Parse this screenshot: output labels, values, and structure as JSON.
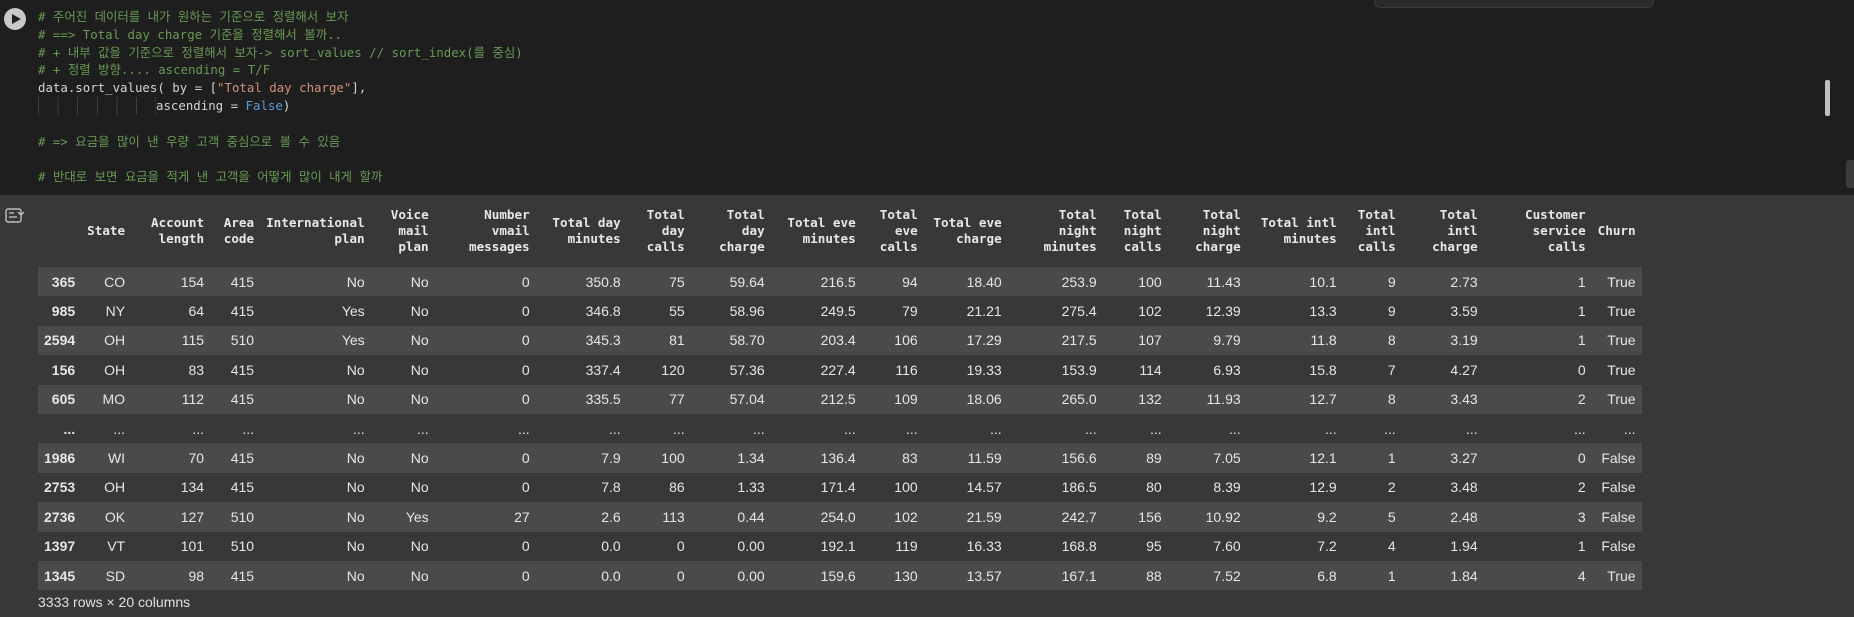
{
  "code": {
    "line1": "# 주어진 데이터를 내가 원하는 기준으로 정렬해서 보자",
    "line2": "# ==> Total day charge 기준을 정렬해서 볼까..",
    "line3": "# + 내부 값을 기준으로 정렬해서 보자-> sort_values // sort_index(를 중심)",
    "line4": "# + 정렬 방향.... ascending = T/F",
    "line5_a": "data.sort_values( by = [",
    "line5_b": "\"Total day charge\"",
    "line5_c": "],",
    "line6_a": "ascending = ",
    "line6_b": "False",
    "line6_c": ")",
    "line8": "# => 요금을 많이 낸 우량 고객 중심으로 볼 수 있음",
    "line10": "# 반대로 보면 요금을 적게 낸 고객을 어떻게 많이 내게 할까"
  },
  "table": {
    "columns": [
      [
        "",
        "",
        ""
      ],
      [
        "",
        "",
        "State"
      ],
      [
        "",
        "Account",
        "length"
      ],
      [
        "",
        "Area",
        "code"
      ],
      [
        "",
        "International",
        "plan"
      ],
      [
        "Voice",
        "mail",
        "plan"
      ],
      [
        "",
        "Number vmail",
        "messages"
      ],
      [
        "",
        "Total day",
        "minutes"
      ],
      [
        "Total",
        "day",
        "calls"
      ],
      [
        "",
        "Total day",
        "charge"
      ],
      [
        "",
        "Total eve",
        "minutes"
      ],
      [
        "Total",
        "eve",
        "calls"
      ],
      [
        "",
        "Total eve",
        "charge"
      ],
      [
        "Total",
        "night",
        "minutes"
      ],
      [
        "Total",
        "night",
        "calls"
      ],
      [
        "Total",
        "night",
        "charge"
      ],
      [
        "",
        "Total intl",
        "minutes"
      ],
      [
        "Total",
        "intl",
        "calls"
      ],
      [
        "Total",
        "intl",
        "charge"
      ],
      [
        "Customer",
        "service",
        "calls"
      ],
      [
        "",
        "",
        "Churn"
      ]
    ],
    "rows": [
      [
        "365",
        "CO",
        "154",
        "415",
        "No",
        "No",
        "0",
        "350.8",
        "75",
        "59.64",
        "216.5",
        "94",
        "18.40",
        "253.9",
        "100",
        "11.43",
        "10.1",
        "9",
        "2.73",
        "1",
        "True"
      ],
      [
        "985",
        "NY",
        "64",
        "415",
        "Yes",
        "No",
        "0",
        "346.8",
        "55",
        "58.96",
        "249.5",
        "79",
        "21.21",
        "275.4",
        "102",
        "12.39",
        "13.3",
        "9",
        "3.59",
        "1",
        "True"
      ],
      [
        "2594",
        "OH",
        "115",
        "510",
        "Yes",
        "No",
        "0",
        "345.3",
        "81",
        "58.70",
        "203.4",
        "106",
        "17.29",
        "217.5",
        "107",
        "9.79",
        "11.8",
        "8",
        "3.19",
        "1",
        "True"
      ],
      [
        "156",
        "OH",
        "83",
        "415",
        "No",
        "No",
        "0",
        "337.4",
        "120",
        "57.36",
        "227.4",
        "116",
        "19.33",
        "153.9",
        "114",
        "6.93",
        "15.8",
        "7",
        "4.27",
        "0",
        "True"
      ],
      [
        "605",
        "MO",
        "112",
        "415",
        "No",
        "No",
        "0",
        "335.5",
        "77",
        "57.04",
        "212.5",
        "109",
        "18.06",
        "265.0",
        "132",
        "11.93",
        "12.7",
        "8",
        "3.43",
        "2",
        "True"
      ],
      [
        "...",
        "...",
        "...",
        "...",
        "...",
        "...",
        "...",
        "...",
        "...",
        "...",
        "...",
        "...",
        "...",
        "...",
        "...",
        "...",
        "...",
        "...",
        "...",
        "...",
        "..."
      ],
      [
        "1986",
        "WI",
        "70",
        "415",
        "No",
        "No",
        "0",
        "7.9",
        "100",
        "1.34",
        "136.4",
        "83",
        "11.59",
        "156.6",
        "89",
        "7.05",
        "12.1",
        "1",
        "3.27",
        "0",
        "False"
      ],
      [
        "2753",
        "OH",
        "134",
        "415",
        "No",
        "No",
        "0",
        "7.8",
        "86",
        "1.33",
        "171.4",
        "100",
        "14.57",
        "186.5",
        "80",
        "8.39",
        "12.9",
        "2",
        "3.48",
        "2",
        "False"
      ],
      [
        "2736",
        "OK",
        "127",
        "510",
        "No",
        "Yes",
        "27",
        "2.6",
        "113",
        "0.44",
        "254.0",
        "102",
        "21.59",
        "242.7",
        "156",
        "10.92",
        "9.2",
        "5",
        "2.48",
        "3",
        "False"
      ],
      [
        "1397",
        "VT",
        "101",
        "510",
        "No",
        "No",
        "0",
        "0.0",
        "0",
        "0.00",
        "192.1",
        "119",
        "16.33",
        "168.8",
        "95",
        "7.60",
        "7.2",
        "4",
        "1.94",
        "1",
        "False"
      ],
      [
        "1345",
        "SD",
        "98",
        "415",
        "No",
        "No",
        "0",
        "0.0",
        "0",
        "0.00",
        "159.6",
        "130",
        "13.57",
        "167.1",
        "88",
        "7.52",
        "6.8",
        "1",
        "1.84",
        "4",
        "True"
      ]
    ]
  },
  "shape": "3333 rows × 20 columns"
}
